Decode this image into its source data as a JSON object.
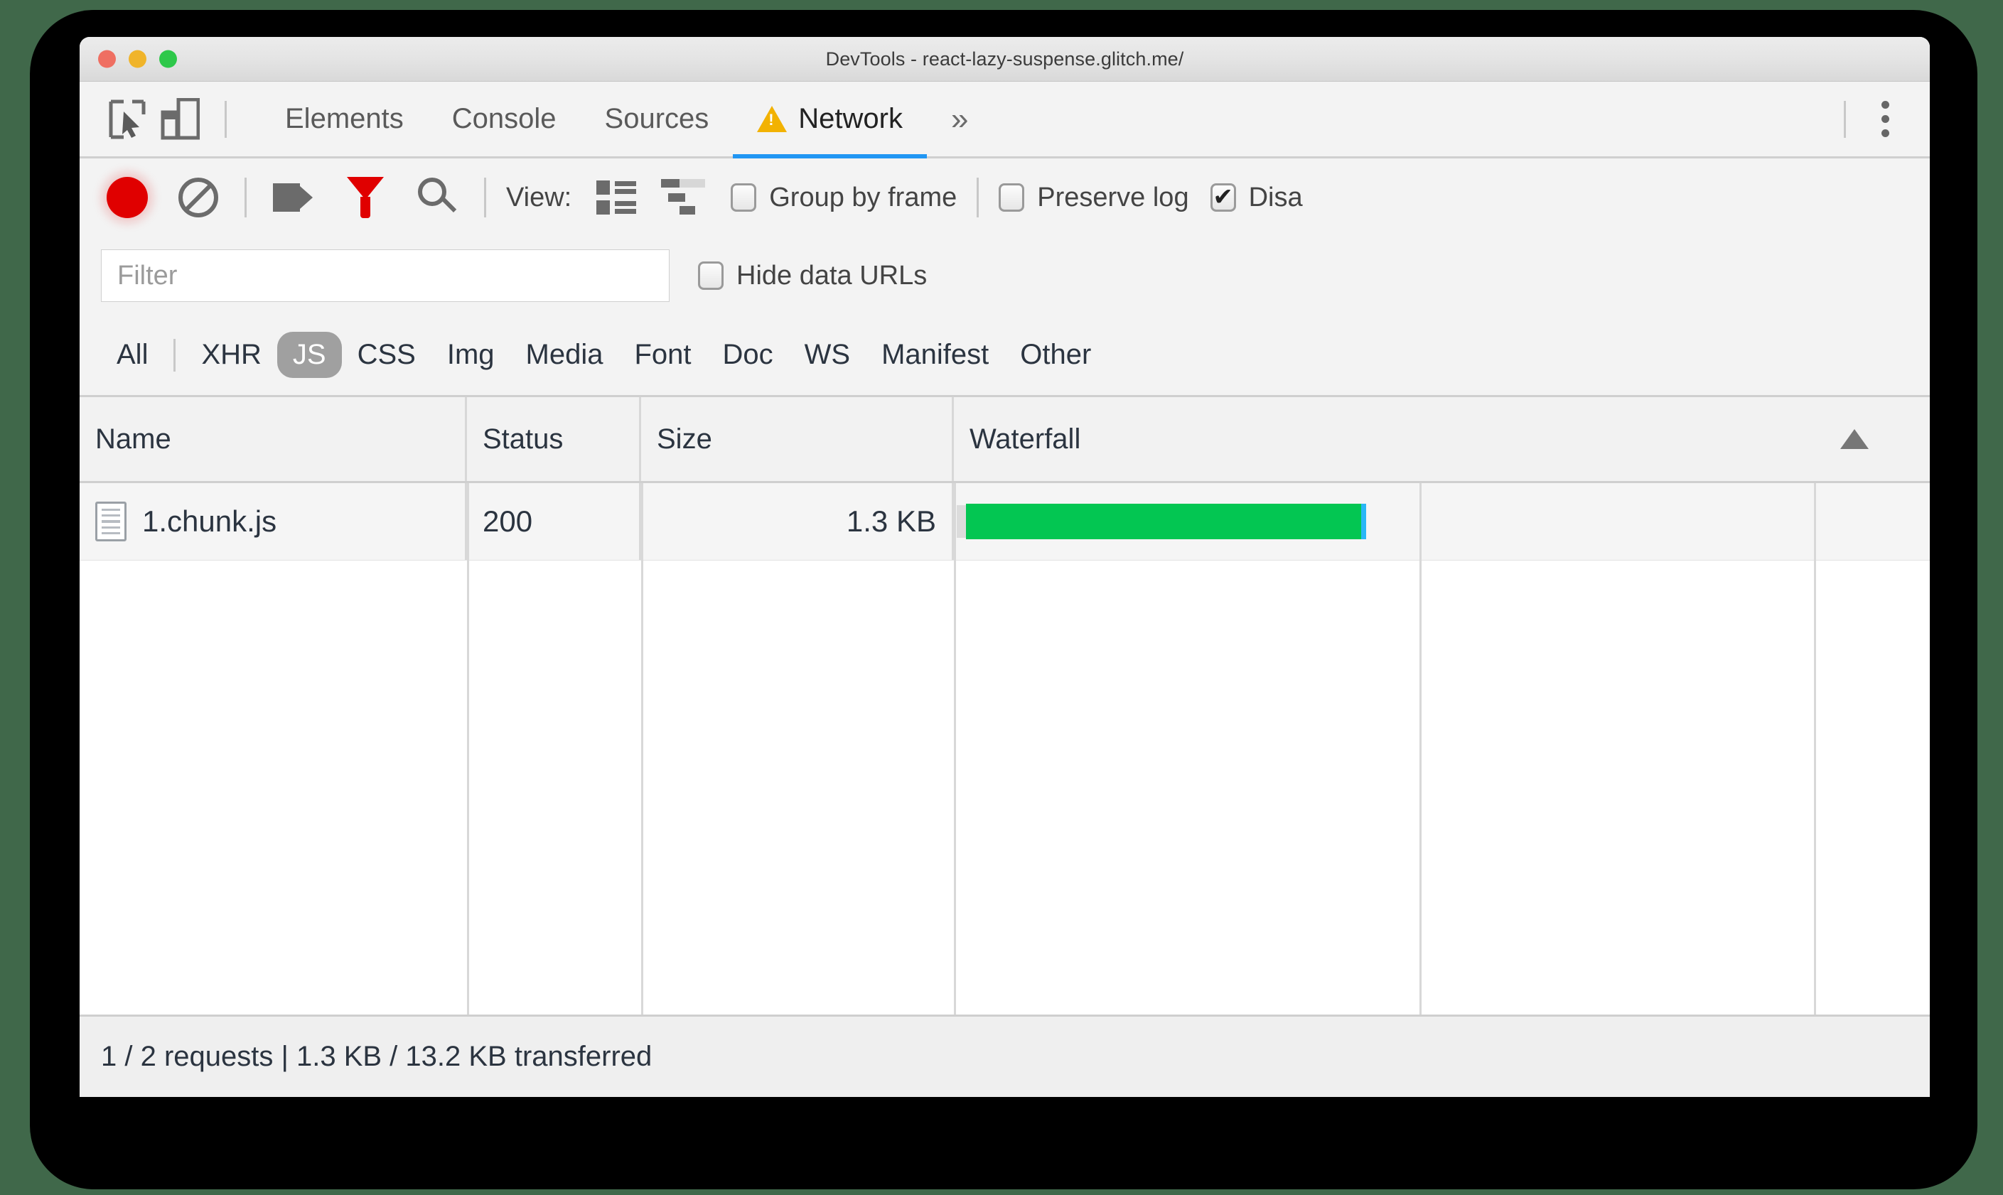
{
  "window": {
    "title": "DevTools - react-lazy-suspense.glitch.me/",
    "traffic_lights": [
      "close",
      "minimize",
      "zoom"
    ]
  },
  "tabbar": {
    "inspect_icon": "inspect-cursor-icon",
    "device_icon": "device-toolbar-icon",
    "tabs": [
      {
        "label": "Elements",
        "active": false
      },
      {
        "label": "Console",
        "active": false
      },
      {
        "label": "Sources",
        "active": false
      },
      {
        "label": "Network",
        "active": true,
        "warning": true
      }
    ],
    "overflow": "»",
    "menu_icon": "kebab-menu-icon"
  },
  "toolbar": {
    "record_icon": "record-icon",
    "clear_icon": "clear-icon",
    "camera_icon": "screenshot-camera-icon",
    "filter_icon": "filter-funnel-icon",
    "search_icon": "search-magnifier-icon",
    "view_label": "View:",
    "view_list_icon": "list-view-icon",
    "view_waterfall_icon": "waterfall-view-icon",
    "checkboxes": [
      {
        "label": "Group by frame",
        "checked": false
      },
      {
        "label": "Preserve log",
        "checked": false
      },
      {
        "label": "Disa",
        "checked": true
      }
    ]
  },
  "filter": {
    "placeholder": "Filter",
    "value": "",
    "hide_data_urls_label": "Hide data URLs",
    "hide_data_urls_checked": false
  },
  "type_chips": [
    {
      "label": "All",
      "selected": false
    },
    {
      "label": "XHR",
      "selected": false
    },
    {
      "label": "JS",
      "selected": true
    },
    {
      "label": "CSS",
      "selected": false
    },
    {
      "label": "Img",
      "selected": false
    },
    {
      "label": "Media",
      "selected": false
    },
    {
      "label": "Font",
      "selected": false
    },
    {
      "label": "Doc",
      "selected": false
    },
    {
      "label": "WS",
      "selected": false
    },
    {
      "label": "Manifest",
      "selected": false
    },
    {
      "label": "Other",
      "selected": false
    }
  ],
  "table": {
    "columns": [
      "Name",
      "Status",
      "Size",
      "Waterfall"
    ],
    "sort_direction": "ascending",
    "rows": [
      {
        "name": "1.chunk.js",
        "status": "200",
        "size": "1.3 KB",
        "icon": "script-file-icon",
        "waterfall": {
          "start_pct": 0,
          "width_pct": 41,
          "color": "#03c652",
          "edge_color": "#29b6f6"
        }
      }
    ]
  },
  "statusbar": {
    "text": "1 / 2 requests | 1.3 KB / 13.2 KB transferred"
  }
}
